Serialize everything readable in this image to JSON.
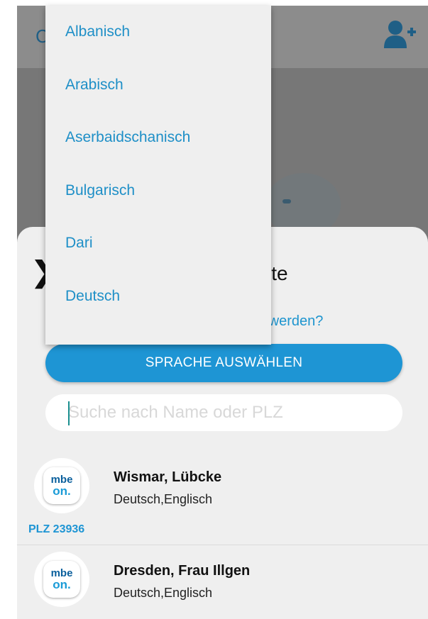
{
  "appbar": {
    "title_fragment": "C"
  },
  "sheet": {
    "close_glyph": "❯",
    "title_fragment": "iste",
    "question_fragment": "n werden?",
    "language_button_label": "SPRACHE AUSWÄHLEN",
    "search_placeholder": "Suche nach Name oder PLZ"
  },
  "dropdown": {
    "items": [
      "Albanisch",
      "Arabisch",
      "Aserbaidschanisch",
      "Bulgarisch",
      "Dari",
      "Deutsch"
    ]
  },
  "results": [
    {
      "name": "Wismar, Lübcke",
      "languages": "Deutsch,Englisch",
      "plz": "PLZ 23936",
      "logo_top": "mbe",
      "logo_bottom": "on."
    },
    {
      "name": "Dresden, Frau Illgen",
      "languages": "Deutsch,Englisch",
      "logo_top": "mbe",
      "logo_bottom": "on."
    }
  ],
  "colors": {
    "accent": "#1e95d4",
    "overlay": "#777777",
    "sheet": "#efefef"
  },
  "icons": [
    "add-user-icon",
    "close-icon",
    "mbeon-logo"
  ]
}
